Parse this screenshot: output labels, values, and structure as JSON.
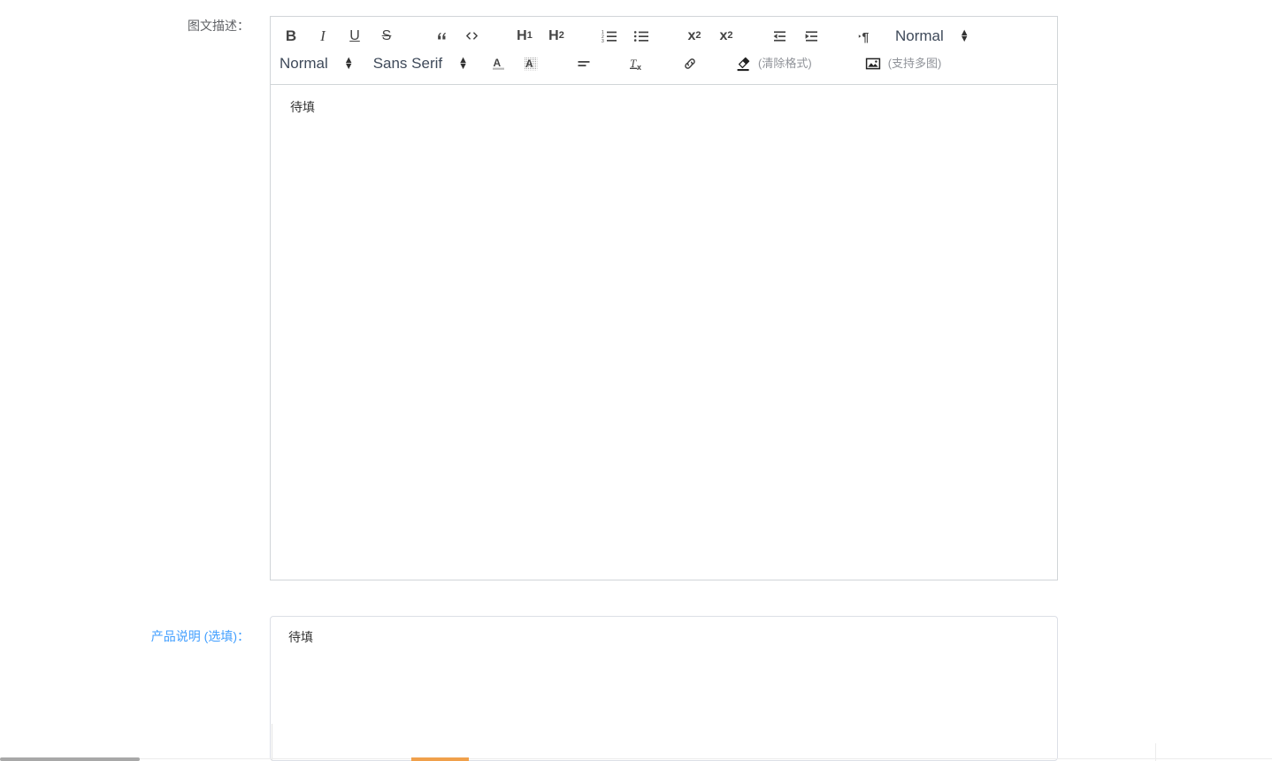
{
  "form": {
    "fields": [
      {
        "id": "image-text-description",
        "label": "图文描述：",
        "label_color": "#606266",
        "type": "rich-text-editor",
        "value": "待填"
      },
      {
        "id": "product-description",
        "label": "产品说明 (选填)：",
        "label_color": "#409eff",
        "type": "textarea",
        "value": "待填"
      }
    ]
  },
  "editor": {
    "toolbar": {
      "row1": [
        {
          "name": "bold-icon",
          "label": "B"
        },
        {
          "name": "italic-icon",
          "label": "I"
        },
        {
          "name": "underline-icon",
          "label": "U"
        },
        {
          "name": "strikethrough-icon",
          "label": "S"
        },
        {
          "name": "blockquote-icon",
          "label": "”"
        },
        {
          "name": "code-block-icon",
          "label": "</>"
        },
        {
          "name": "header-1-icon",
          "label": "H1"
        },
        {
          "name": "header-2-icon",
          "label": "H2"
        },
        {
          "name": "ordered-list-icon",
          "label": "1 2 3"
        },
        {
          "name": "bullet-list-icon",
          "label": "•"
        },
        {
          "name": "subscript-icon",
          "label": "x2"
        },
        {
          "name": "superscript-icon",
          "label": "x2"
        },
        {
          "name": "outdent-icon",
          "label": "outdent"
        },
        {
          "name": "indent-icon",
          "label": "indent"
        },
        {
          "name": "text-direction-icon",
          "label": "¶"
        },
        {
          "name": "line-height-picker",
          "label": "Normal"
        }
      ],
      "row2": [
        {
          "name": "size-picker",
          "label": "Normal"
        },
        {
          "name": "font-family-picker",
          "label": "Sans Serif"
        },
        {
          "name": "text-color-icon",
          "label": "A"
        },
        {
          "name": "background-color-icon",
          "label": "A"
        },
        {
          "name": "align-icon",
          "label": "align"
        },
        {
          "name": "clean-format-icon",
          "label": "Tx"
        },
        {
          "name": "link-icon",
          "label": "link"
        },
        {
          "name": "eraser-icon",
          "label": "eraser"
        },
        {
          "name": "image-icon",
          "label": "image"
        }
      ],
      "line_height_value": "Normal",
      "size_value": "Normal",
      "font_value": "Sans Serif",
      "clear_format_hint": "(清除格式)",
      "image_hint": "(支持多图)"
    }
  },
  "colors": {
    "label_default": "#606266",
    "label_link": "#409eff",
    "icon": "#444444",
    "picker_text": "#3f4a5a",
    "hint_text": "#909399",
    "border": "#d1d5d8",
    "textarea_border": "#dcdfe6",
    "accent_bottom": "#f0a04b",
    "scrollbar": "#a8a8a8"
  }
}
